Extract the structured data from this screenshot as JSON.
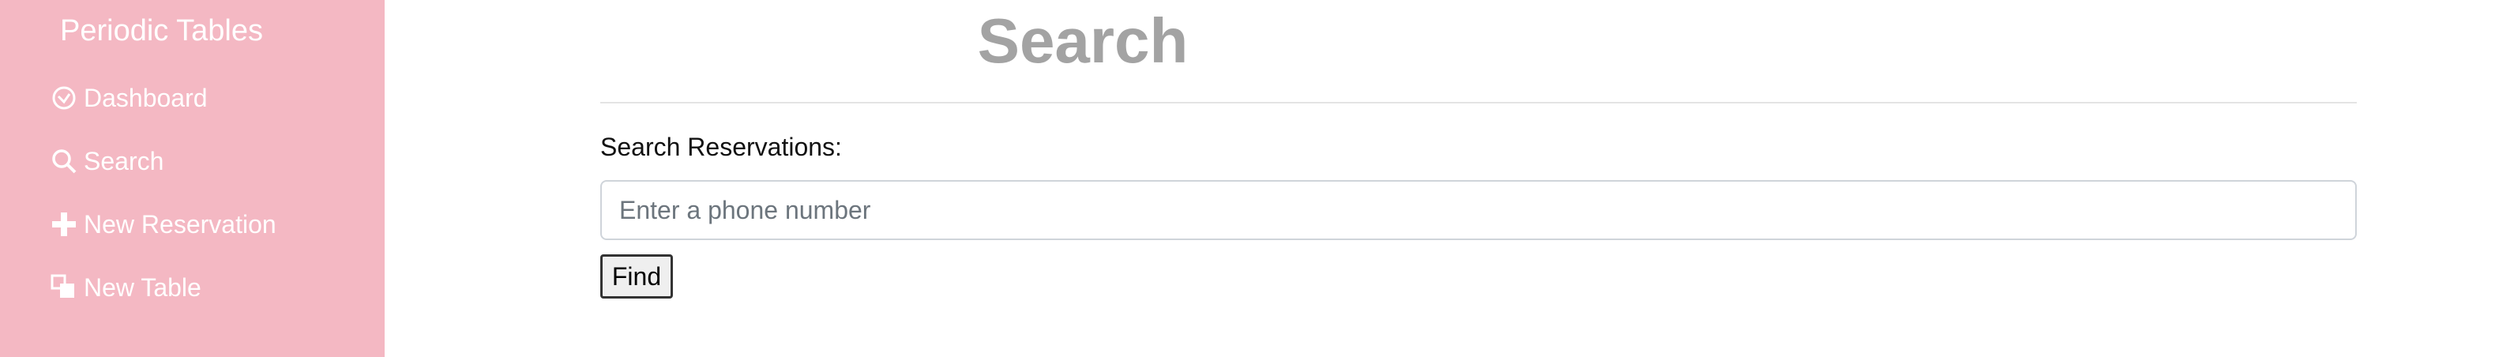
{
  "sidebar": {
    "brand": "Periodic Tables",
    "items": [
      {
        "label": "Dashboard",
        "icon": "dashboard-icon"
      },
      {
        "label": "Search",
        "icon": "search-icon"
      },
      {
        "label": "New Reservation",
        "icon": "plus-icon"
      },
      {
        "label": "New Table",
        "icon": "layers-icon"
      }
    ]
  },
  "main": {
    "title": "Search",
    "search": {
      "label": "Search Reservations:",
      "placeholder": "Enter a phone number",
      "value": "",
      "button_label": "Find"
    }
  },
  "colors": {
    "sidebar_bg": "#f4b8c3",
    "title": "#a3a3a3"
  }
}
